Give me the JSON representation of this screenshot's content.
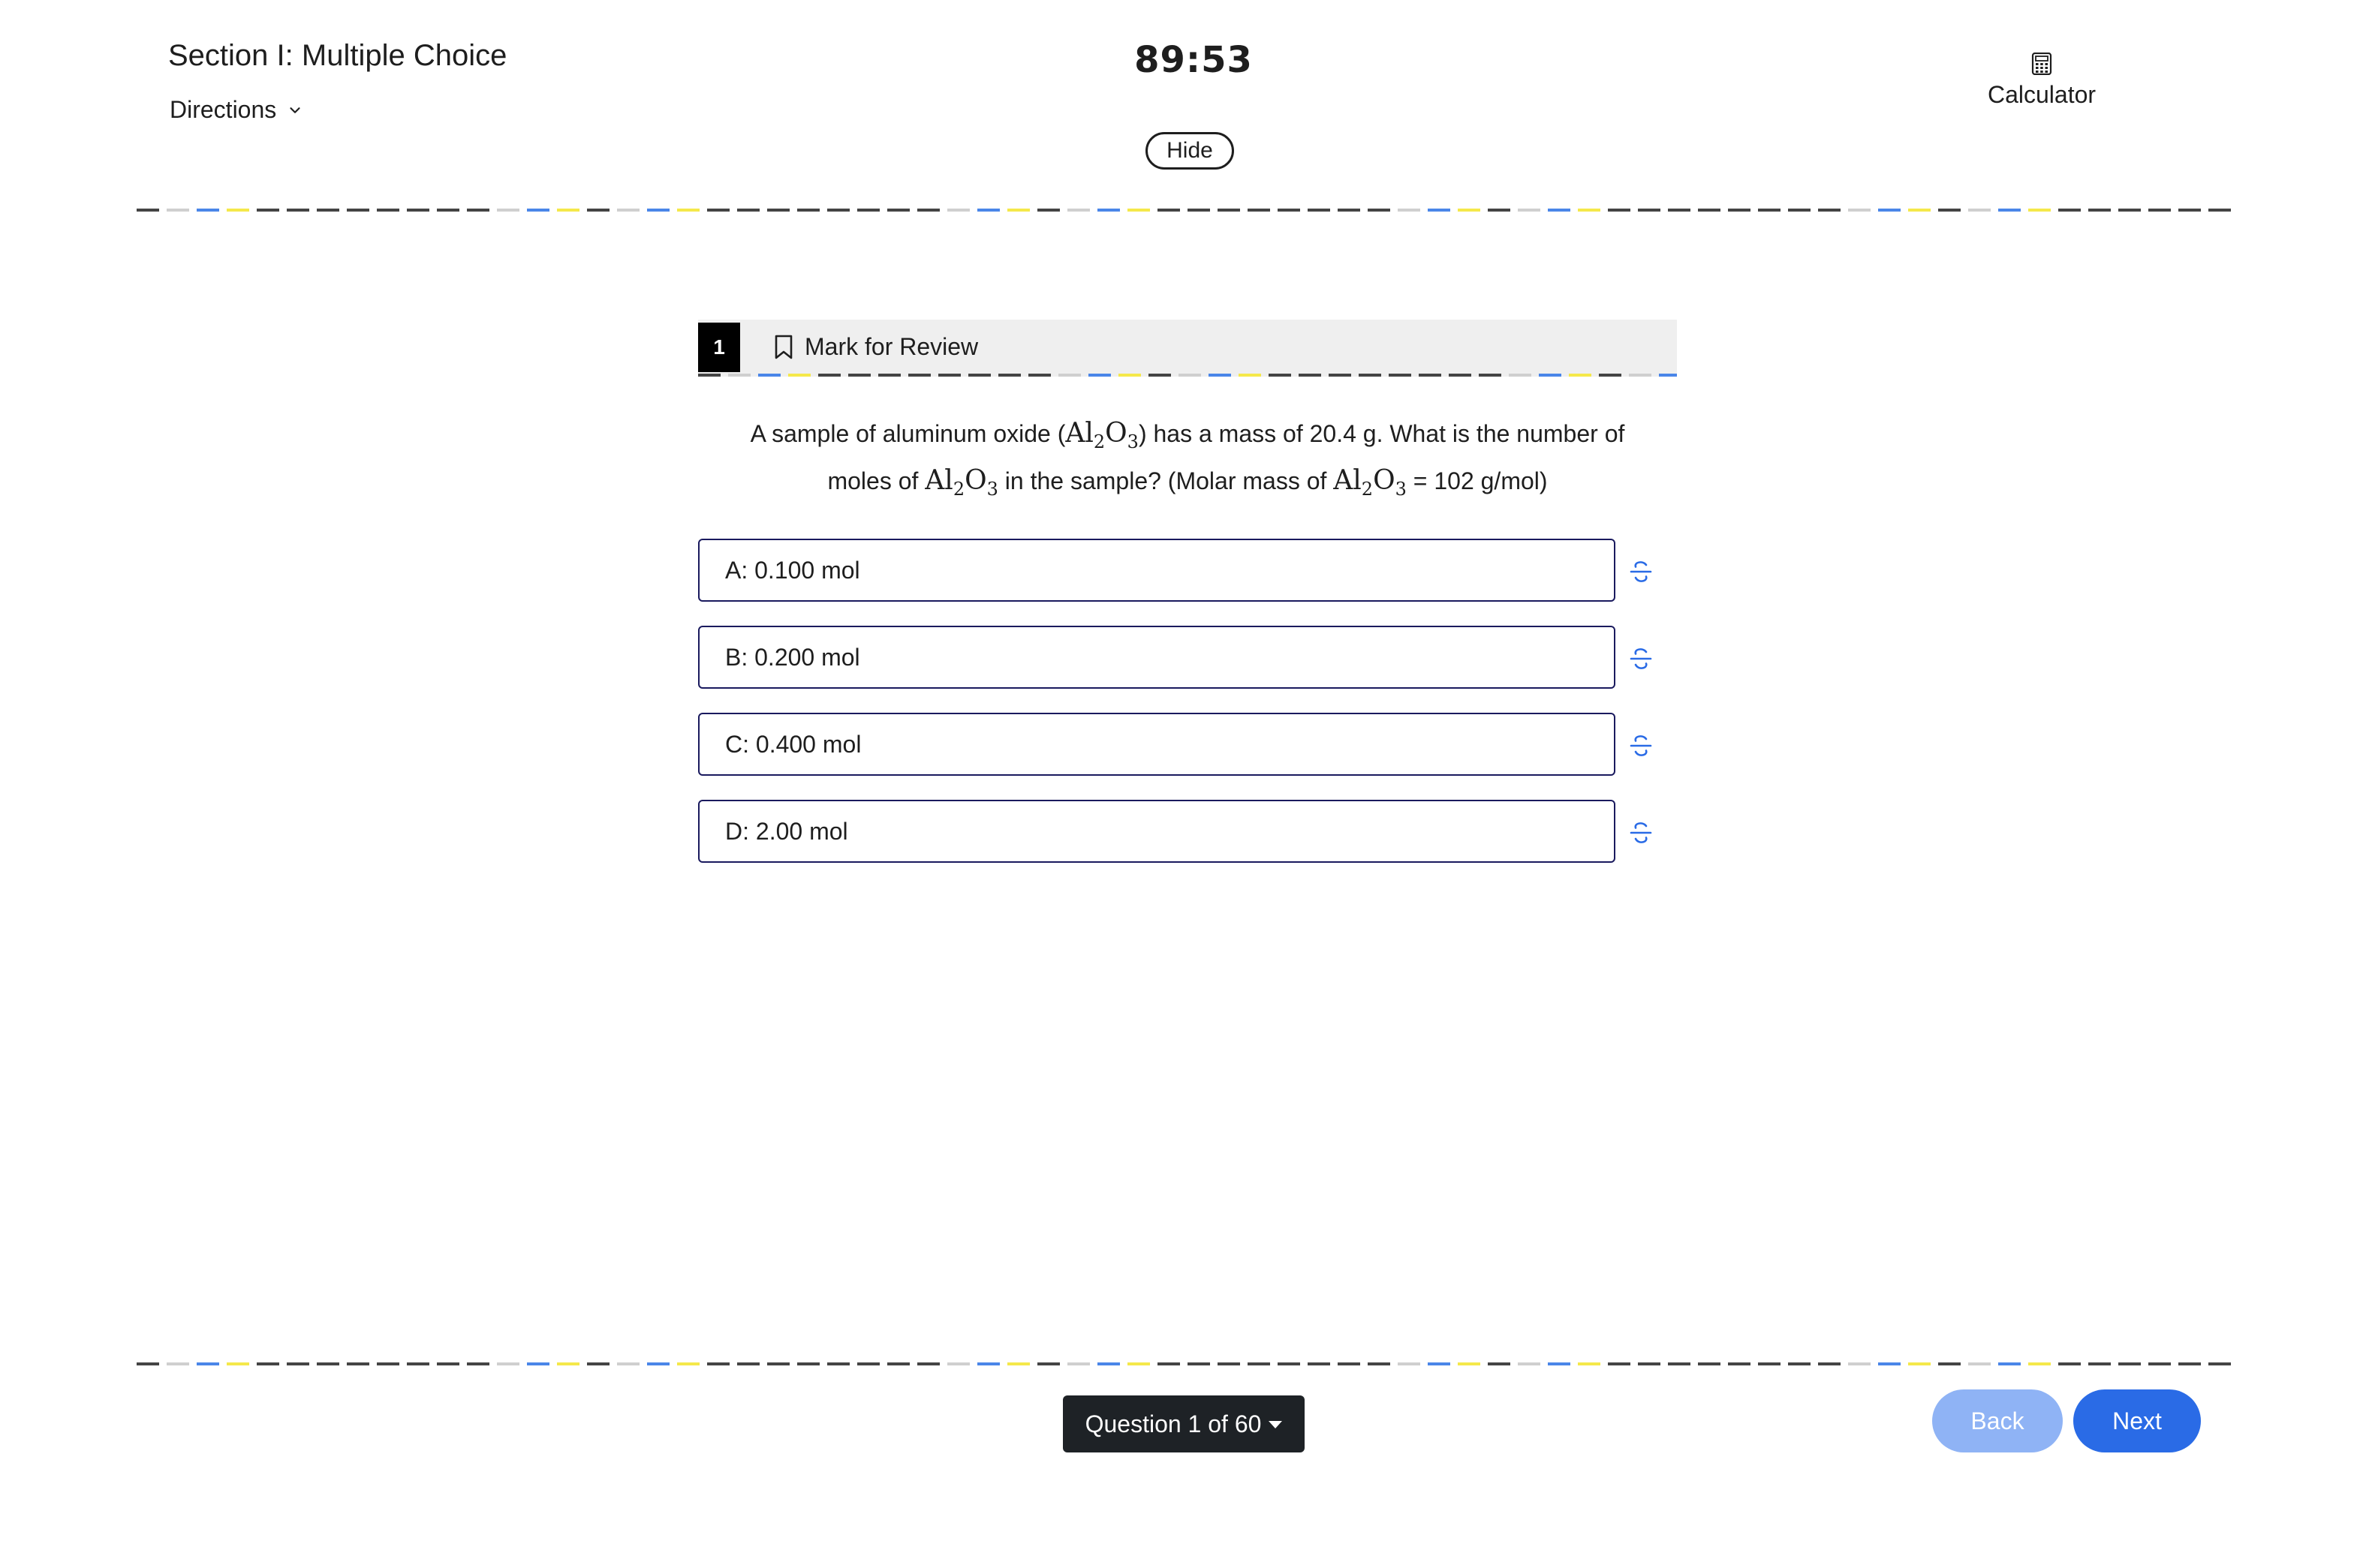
{
  "header": {
    "section_title": "Section I: Multiple Choice",
    "directions_label": "Directions",
    "timer": "89:53",
    "hide_label": "Hide",
    "calculator_label": "Calculator"
  },
  "question": {
    "number": "1",
    "mark_review_label": "Mark for Review",
    "text_parts": {
      "p1": "A sample of aluminum oxide (",
      "p2": ") has a mass of 20.4 g. What is the number of",
      "p3": "moles of ",
      "p4": " in the sample? (Molar mass of ",
      "p5": " = 102 g/mol)"
    },
    "formula": {
      "al": "Al",
      "al_sub": "2",
      "o": "O",
      "o_sub": "3"
    }
  },
  "choices": [
    {
      "label": "A: 0.100 mol"
    },
    {
      "label": "B: 0.200 mol"
    },
    {
      "label": "C: 0.400 mol"
    },
    {
      "label": "D: 2.00 mol"
    }
  ],
  "footer": {
    "question_nav": "Question 1 of 60",
    "back_label": "Back",
    "next_label": "Next"
  },
  "colors": {
    "accent": "#2a6be6",
    "accent_disabled": "#8fb3f5",
    "choice_border": "#1a1a5e",
    "nav_bg": "#1e2226"
  },
  "icons": {
    "directions": "chevron-down-icon",
    "calculator": "calculator-icon",
    "mark_review": "bookmark-icon",
    "strikethrough": "strikethrough-icon"
  }
}
